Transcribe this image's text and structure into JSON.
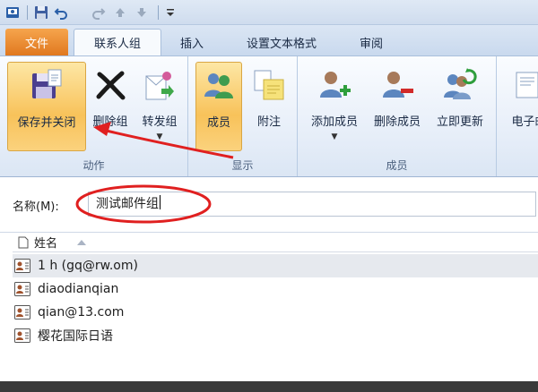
{
  "quick_access": {
    "icons": [
      "app-icon",
      "save-icon",
      "undo-icon",
      "redo-icon",
      "up-arrow-icon",
      "down-arrow-icon",
      "customize-toolbar-icon"
    ]
  },
  "tabs": [
    {
      "label": "文件"
    },
    {
      "label": "联系人组"
    },
    {
      "label": "插入"
    },
    {
      "label": "设置文本格式"
    },
    {
      "label": "审阅"
    }
  ],
  "ribbon": {
    "groups": {
      "actions": {
        "label": "动作",
        "buttons": {
          "save_close": "保存并关闭",
          "delete_group": "删除组",
          "forward_group": "转发组"
        }
      },
      "show": {
        "label": "显示",
        "buttons": {
          "members": "成员",
          "notes": "附注"
        }
      },
      "members": {
        "label": "成员",
        "buttons": {
          "add_member": "添加成员",
          "remove_member": "删除成员",
          "update_now": "立即更新"
        }
      },
      "partial": {
        "label": "电子邮"
      }
    }
  },
  "name_field": {
    "label": "名称(M):",
    "value": "测试邮件组"
  },
  "member_list": {
    "header": "姓名",
    "rows": [
      {
        "name": "1 h (gq@rw.om)",
        "selected": true
      },
      {
        "name": "diaodianqian",
        "selected": false
      },
      {
        "name": "qian@13.com",
        "selected": false
      },
      {
        "name": "樱花国际日语",
        "selected": false
      }
    ]
  },
  "colors": {
    "file_tab": "#e0781f",
    "annotation_red": "#e02020",
    "highlight": "#f8c25a"
  }
}
